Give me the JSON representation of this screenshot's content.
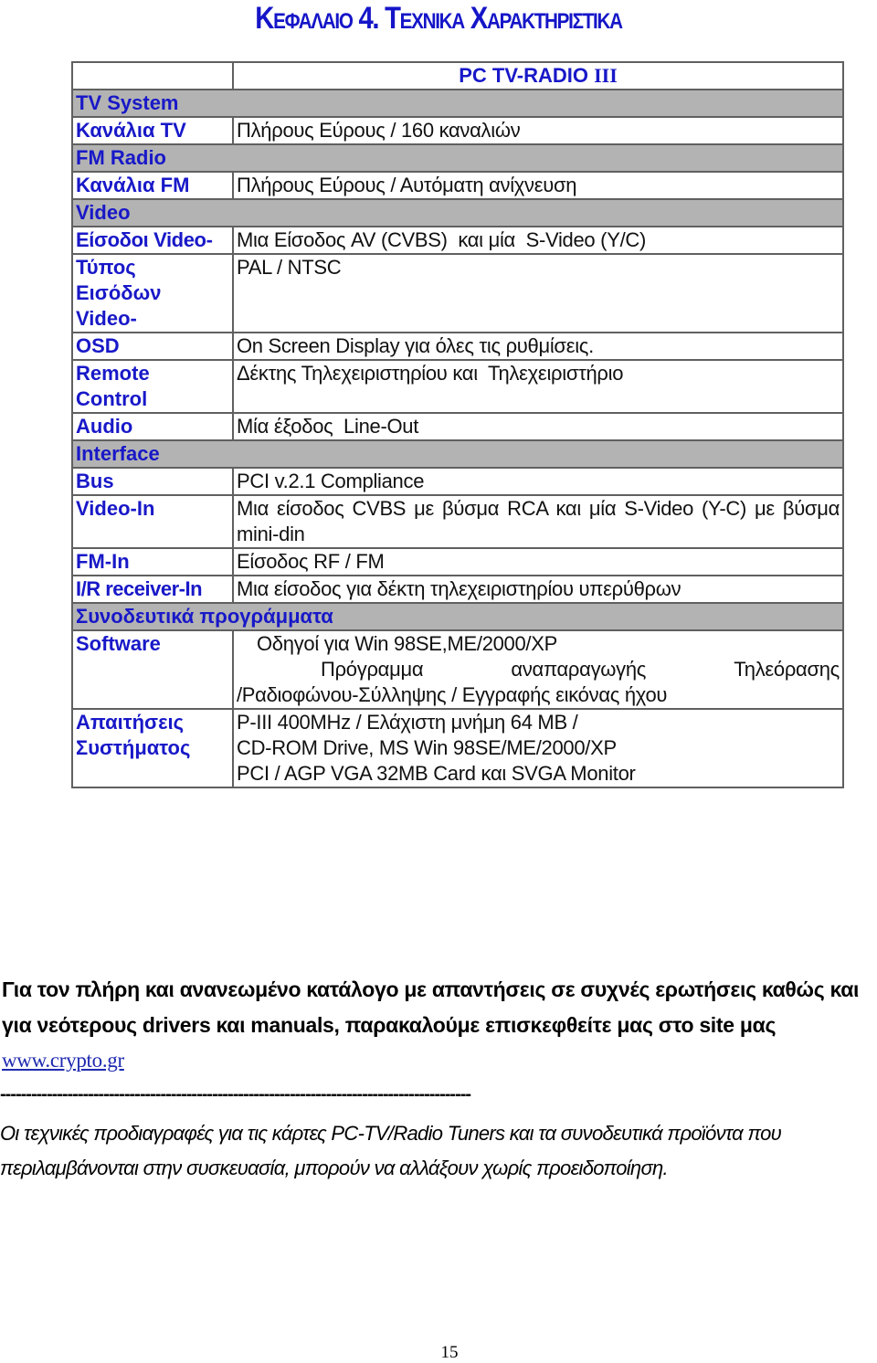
{
  "chapter_title": "Κεφαλαιο 4. Τεχνικα Χαρακτηριστικα",
  "table": {
    "header": {
      "label": "",
      "product_prefix": "PC TV-RADIO ",
      "product_suffix": "III"
    },
    "rows": [
      {
        "type": "section",
        "label": "TV System"
      },
      {
        "type": "row",
        "label": "Κανάλια TV",
        "value": "Πλήρους Εύρους / 160 καναλιών"
      },
      {
        "type": "section",
        "label": "FM Radio"
      },
      {
        "type": "row",
        "label": "Κανάλια FM",
        "value": "Πλήρους Εύρους / Αυτόματη ανίχνευση"
      },
      {
        "type": "section",
        "label": "Video"
      },
      {
        "type": "row",
        "label": "Είσοδοι Video-",
        "value": "Μια Είσοδος AV (CVBS)  και μία  S-Video (Y/C)"
      },
      {
        "type": "row",
        "label_lines": [
          "Τύπος",
          "Εισόδων",
          "Video-"
        ],
        "value": "PAL / NTSC"
      },
      {
        "type": "row",
        "label": "OSD",
        "value": "On Screen Display για όλες τις ρυθμίσεις."
      },
      {
        "type": "row",
        "label_lines": [
          "Remote",
          "Control"
        ],
        "value": "Δέκτης Τηλεχειριστηρίου και  Τηλεχειριστήριο"
      },
      {
        "type": "row",
        "label": "Audio",
        "value": "Μία έξοδος  Line-Out"
      },
      {
        "type": "section",
        "label": "Interface"
      },
      {
        "type": "row",
        "label": "Bus",
        "value": "PCI v.2.1 Compliance"
      },
      {
        "type": "row",
        "label": "Video-In",
        "value": "Μια είσοδος CVBS με βύσμα RCA και μία S-Video (Y-C) με βύσμα  mini-din"
      },
      {
        "type": "row",
        "label": "FM-In",
        "value": "Είσοδος RF / FM"
      },
      {
        "type": "row",
        "label": "I/R receiver-In",
        "value": "Μια είσοδος για δέκτη τηλεχειριστηρίου υπερύθρων"
      },
      {
        "type": "section",
        "label": "Συνοδευτικά προγράμματα"
      },
      {
        "type": "row",
        "label": "Software",
        "value_lines": [
          "Οδηγοί για Win 98SE,ME/2000/XP"
        ],
        "value_spread": [
          "Πρόγραμμα",
          "αναπαραγωγής",
          "Τηλεόρασης"
        ],
        "value_tail": "/Ραδιοφώνου-Σύλληψης / Εγγραφής εικόνας ήχου"
      },
      {
        "type": "row",
        "label_lines": [
          "Απαιτήσεις",
          "Συστήματος"
        ],
        "value_lines": [
          "P-III 400MHz / Ελάχιστη μνήμη 64 MB /",
          "CD-ROM Drive, MS Win 98SE/ME/2000/XP",
          "PCI / AGP VGA 32MB Card και SVGA Monitor"
        ]
      }
    ]
  },
  "footer": {
    "notice_text": "Για τον πλήρη και ανανεωμένο κατάλογο με απαντήσεις σε συχνές ερωτήσεις καθώς και για νεότερους drivers και manuals, παρακαλούμε επισκεφθείτε μας στο site μας ",
    "link_text": "www.crypto.gr",
    "separator": "-------------------------------------------------------------------------------------------",
    "disclaimer": "Οι τεχνικές προδιαγραφές για τις κάρτες PC-TV/Radio Tuners και τα συνοδευτικά προϊόντα που περιλαμβάνονται στην συσκευασία, μπορούν να αλλάξουν χωρίς προειδοποίηση."
  },
  "page_number": "15",
  "colors": {
    "label_blue": "#1818c8",
    "section_gray": "#b3b3b3",
    "link_blue": "#1f2ab0",
    "border": "#606060"
  }
}
